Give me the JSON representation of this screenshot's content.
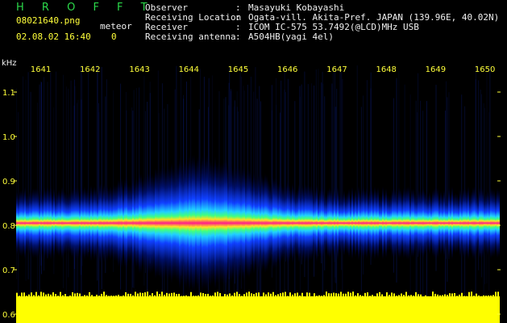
{
  "header": {
    "app_title": "H R O F F T",
    "filename": "08021640.png",
    "datetime": "02.08.02 16:40",
    "meteor_label": "meteor",
    "meteor_count": "0",
    "info": [
      {
        "key": "Observer",
        "value": "Masayuki Kobayashi"
      },
      {
        "key": "Receiving Location",
        "value": "Ogata-vill. Akita-Pref. JAPAN (139.96E, 40.02N)"
      },
      {
        "key": "Receiver",
        "value": "ICOM IC-575 53.7492(@LCD)MHz USB"
      },
      {
        "key": "Receiving antenna",
        "value": "A504HB(yagi 4el)"
      }
    ]
  },
  "colors": {
    "background": "#000000",
    "label_yellow": "#ffff3a",
    "title_green": "#2bd94a",
    "noise_floor_yellow": "#ffff00",
    "signal_core": "#ff1a8c"
  },
  "chart_data": {
    "type": "heatmap",
    "ylabel": "kHz",
    "x_ticks": [
      "1641",
      "1642",
      "1643",
      "1644",
      "1645",
      "1646",
      "1647",
      "1648",
      "1649",
      "1650"
    ],
    "y_ticks": [
      "1.1",
      "1.0",
      "0.9",
      "0.8",
      "0.7",
      "0.6"
    ],
    "y_range": [
      0.58,
      1.18
    ],
    "x_range": [
      1640.5,
      1650.3
    ],
    "signal_center_khz": 0.805,
    "yellow_floor_top_khz": 0.64
  }
}
